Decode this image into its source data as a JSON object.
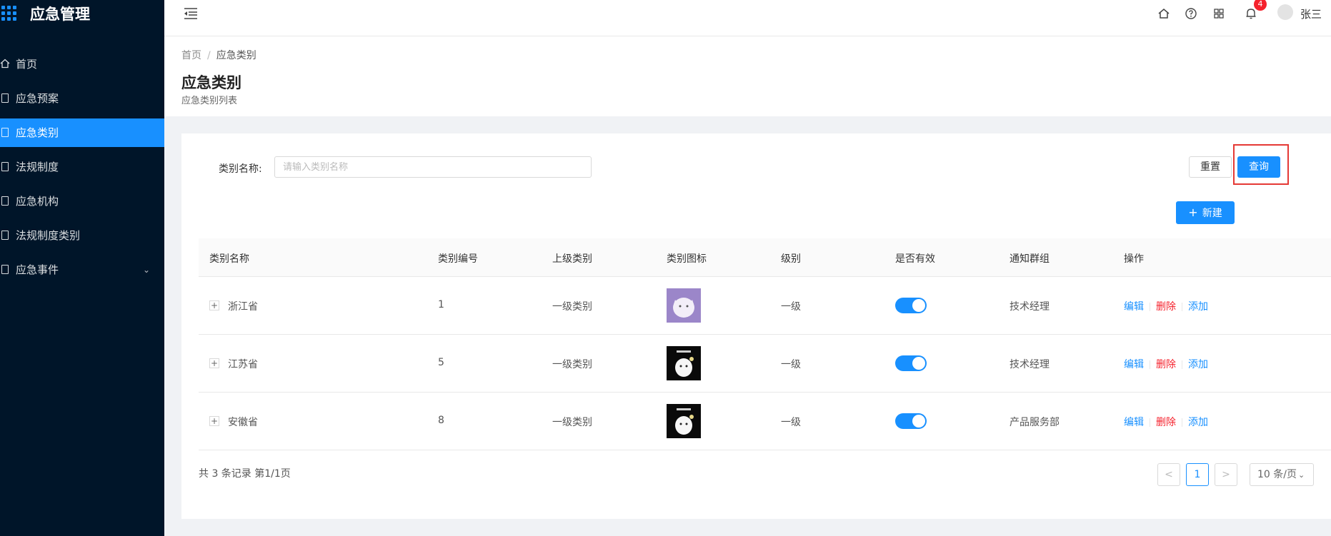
{
  "app": {
    "title": "应急管理"
  },
  "sidebar": {
    "items": [
      {
        "label": "首页",
        "icon": "home-icon"
      },
      {
        "label": "应急预案",
        "icon": "file-icon"
      },
      {
        "label": "应急类别",
        "icon": "file-icon",
        "active": true
      },
      {
        "label": "法规制度",
        "icon": "file-icon"
      },
      {
        "label": "应急机构",
        "icon": "file-icon"
      },
      {
        "label": "法规制度类别",
        "icon": "file-icon"
      },
      {
        "label": "应急事件",
        "icon": "file-icon",
        "has_submenu": true
      }
    ]
  },
  "header": {
    "notification_count": "4",
    "user_name": "张三",
    "icons": [
      "home-icon",
      "help-icon",
      "apps-icon",
      "bell-icon"
    ]
  },
  "breadcrumb": {
    "home": "首页",
    "separator": "/",
    "current": "应急类别"
  },
  "page": {
    "title": "应急类别",
    "subtitle": "应急类别列表"
  },
  "filter": {
    "label": "类别名称:",
    "placeholder": "请输入类别名称",
    "value": "",
    "reset_label": "重置",
    "query_label": "查询",
    "new_label": "新建"
  },
  "table": {
    "columns": [
      "类别名称",
      "类别编号",
      "上级类别",
      "类别图标",
      "级别",
      "是否有效",
      "通知群组",
      "操作"
    ],
    "rows": [
      {
        "name": "浙江省",
        "code": "1",
        "parent": "一级类别",
        "icon": "cartoon-cat-purple",
        "level": "一级",
        "valid": true,
        "group": "技术经理"
      },
      {
        "name": "江苏省",
        "code": "5",
        "parent": "一级类别",
        "icon": "cartoon-cat-black",
        "level": "一级",
        "valid": true,
        "group": "技术经理"
      },
      {
        "name": "安徽省",
        "code": "8",
        "parent": "一级类别",
        "icon": "cartoon-cat-black",
        "level": "一级",
        "valid": true,
        "group": "产品服务部"
      }
    ],
    "actions": {
      "edit": "编辑",
      "delete": "删除",
      "add": "添加"
    },
    "expand_symbol": "+"
  },
  "pagination": {
    "summary": "共 3 条记录 第1/1页",
    "current_page": "1",
    "prev": "<",
    "next": ">",
    "page_size": "10 条/页"
  },
  "colors": {
    "primary": "#1890ff",
    "sidebar_bg": "#001529",
    "danger": "#f5222d",
    "highlight_box": "#e53935"
  }
}
